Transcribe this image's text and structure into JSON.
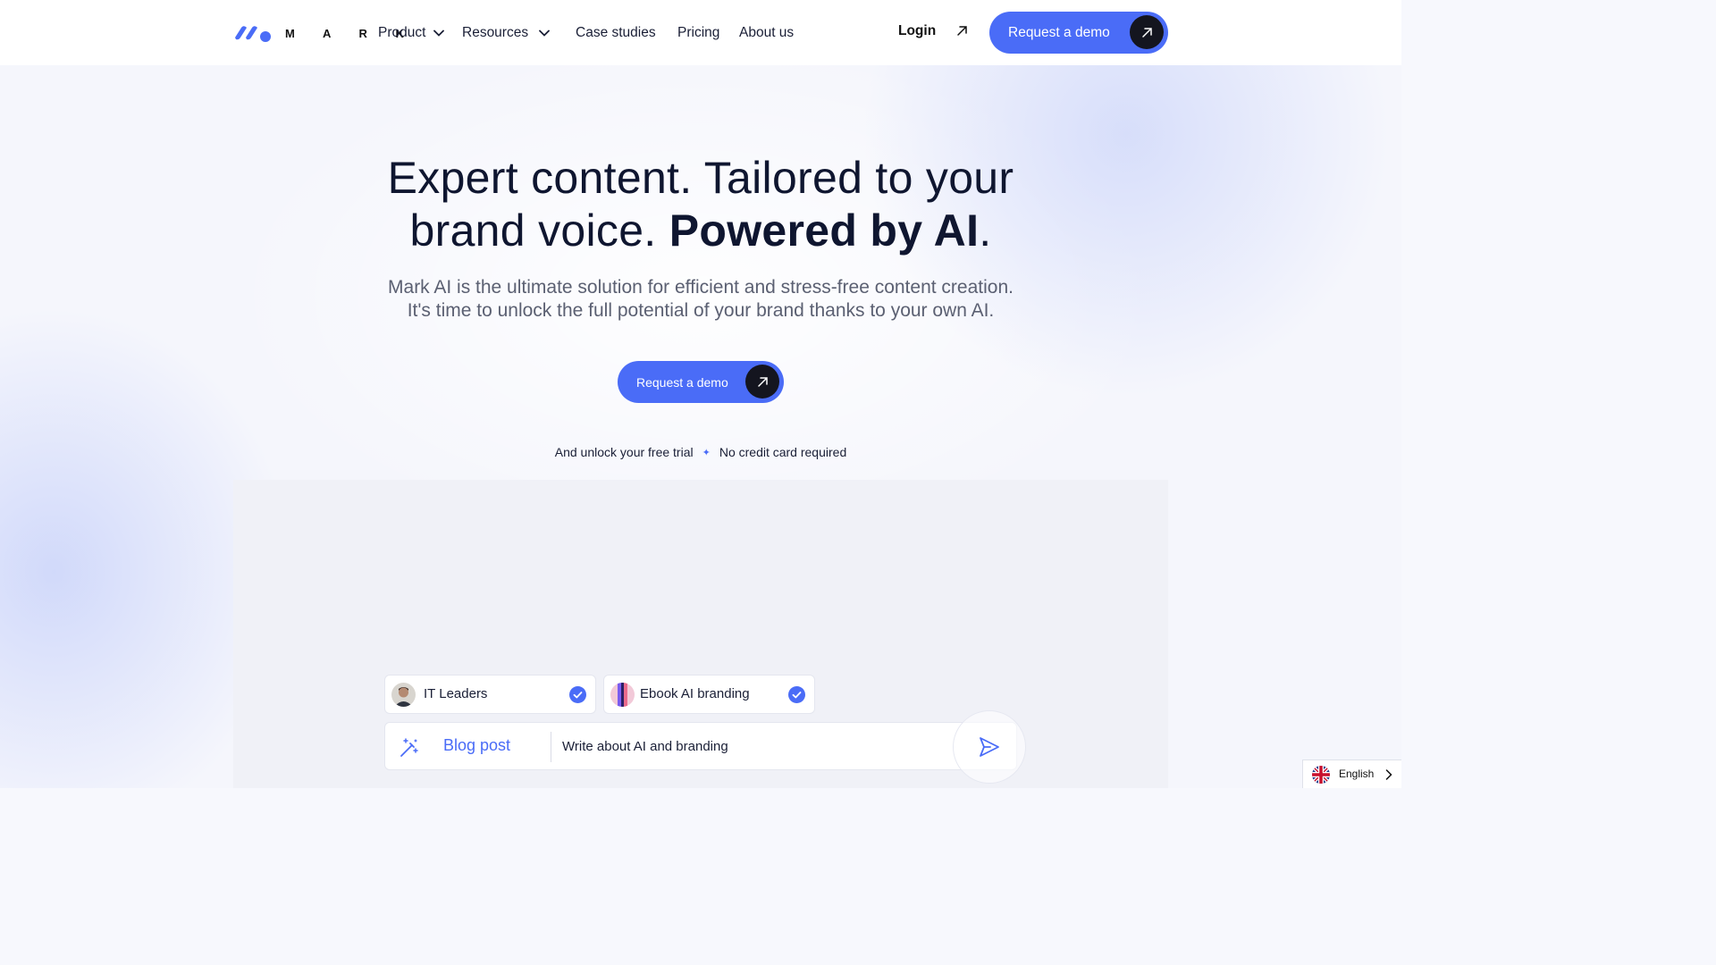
{
  "header": {
    "brand": "M A R K",
    "nav": [
      {
        "label": "Product",
        "has_dropdown": true
      },
      {
        "label": "Resources",
        "has_dropdown": true
      },
      {
        "label": "Case studies",
        "has_dropdown": false
      },
      {
        "label": "Pricing",
        "has_dropdown": false
      },
      {
        "label": "About us",
        "has_dropdown": false
      }
    ],
    "login_label": "Login",
    "demo_button_label": "Request a demo"
  },
  "hero": {
    "title_line1": "Expert content. Tailored to your",
    "title_line2_prefix": "brand voice. ",
    "title_line2_bold": "Powered by AI",
    "title_line2_suffix": ".",
    "subtitle_line1": "Mark AI is the ultimate solution for efficient and stress-free content creation.",
    "subtitle_line2": "It's time to unlock the full potential of your brand thanks to your own AI.",
    "cta_label": "Request a demo",
    "trial_text": "And unlock your free trial",
    "trial_separator": "✦",
    "no_card_text": "No credit card required"
  },
  "demo": {
    "chips": [
      {
        "label": "IT Leaders",
        "checked": true,
        "avatar": "person-avatar"
      },
      {
        "label": "Ebook AI branding",
        "checked": true,
        "avatar": "ebook-thumbnail"
      }
    ],
    "content_type": "Blog post",
    "prompt": "Write about AI and branding"
  },
  "language": {
    "label": "English",
    "flag": "uk-flag-icon"
  },
  "colors": {
    "accent": "#4a6cf7",
    "dark": "#14151f",
    "text": "#0f1630",
    "muted": "#5b6072"
  }
}
